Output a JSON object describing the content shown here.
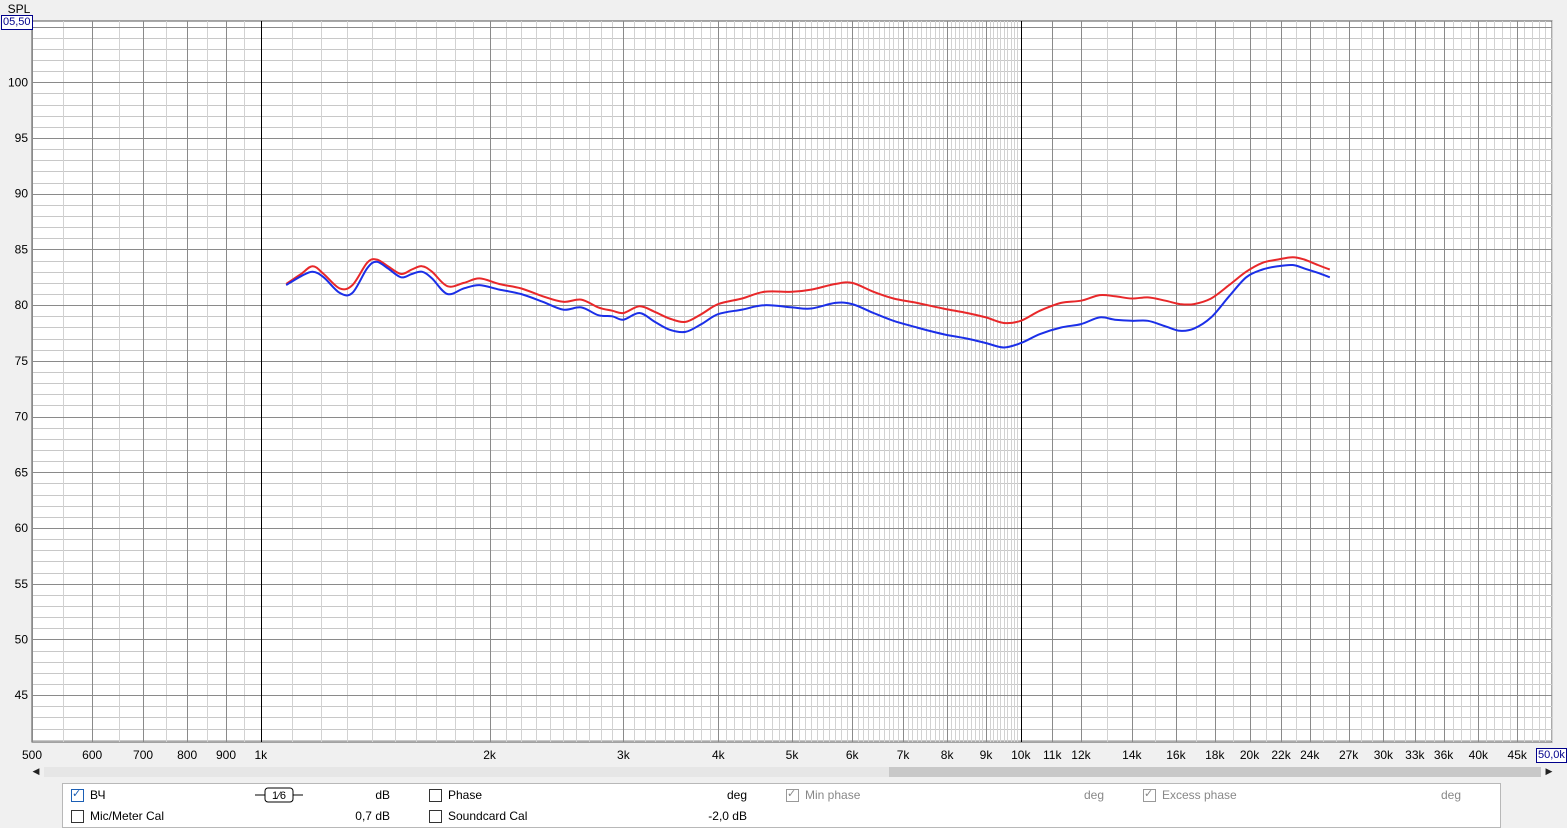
{
  "chart_data": {
    "type": "line",
    "y_axis_title": "SPL",
    "x_scale": "log",
    "xlim": [
      500,
      50000
    ],
    "ylim": [
      40.8,
      105.5
    ],
    "y_ticks": [
      45,
      50,
      55,
      60,
      65,
      70,
      75,
      80,
      85,
      90,
      95,
      100
    ],
    "x_tick_labels": [
      {
        "v": 500,
        "t": "500"
      },
      {
        "v": 600,
        "t": "600"
      },
      {
        "v": 700,
        "t": "700"
      },
      {
        "v": 800,
        "t": "800"
      },
      {
        "v": 900,
        "t": "900"
      },
      {
        "v": 1000,
        "t": "1k"
      },
      {
        "v": 2000,
        "t": "2k"
      },
      {
        "v": 3000,
        "t": "3k"
      },
      {
        "v": 4000,
        "t": "4k"
      },
      {
        "v": 5000,
        "t": "5k"
      },
      {
        "v": 6000,
        "t": "6k"
      },
      {
        "v": 7000,
        "t": "7k"
      },
      {
        "v": 8000,
        "t": "8k"
      },
      {
        "v": 9000,
        "t": "9k"
      },
      {
        "v": 10000,
        "t": "10k"
      },
      {
        "v": 11000,
        "t": "11k"
      },
      {
        "v": 12000,
        "t": "12k"
      },
      {
        "v": 14000,
        "t": "14k"
      },
      {
        "v": 16000,
        "t": "16k"
      },
      {
        "v": 18000,
        "t": "18k"
      },
      {
        "v": 20000,
        "t": "20k"
      },
      {
        "v": 22000,
        "t": "22k"
      },
      {
        "v": 24000,
        "t": "24k"
      },
      {
        "v": 27000,
        "t": "27k"
      },
      {
        "v": 30000,
        "t": "30k"
      },
      {
        "v": 33000,
        "t": "33k"
      },
      {
        "v": 36000,
        "t": "36k"
      },
      {
        "v": 40000,
        "t": "40k"
      },
      {
        "v": 45000,
        "t": "45k"
      }
    ],
    "y_max_readout": "05,50",
    "x_max_readout": "50,0k",
    "grid": true,
    "series": [
      {
        "color": "#e8282a",
        "points": [
          [
            1080,
            81.9
          ],
          [
            1130,
            82.8
          ],
          [
            1170,
            83.5
          ],
          [
            1210,
            82.8
          ],
          [
            1270,
            81.5
          ],
          [
            1320,
            81.8
          ],
          [
            1380,
            83.8
          ],
          [
            1420,
            84.1
          ],
          [
            1470,
            83.5
          ],
          [
            1530,
            82.8
          ],
          [
            1580,
            83.2
          ],
          [
            1630,
            83.5
          ],
          [
            1680,
            83.0
          ],
          [
            1760,
            81.7
          ],
          [
            1850,
            82.0
          ],
          [
            1940,
            82.4
          ],
          [
            2060,
            81.9
          ],
          [
            2200,
            81.5
          ],
          [
            2350,
            80.8
          ],
          [
            2500,
            80.3
          ],
          [
            2640,
            80.5
          ],
          [
            2780,
            79.8
          ],
          [
            2900,
            79.5
          ],
          [
            3000,
            79.3
          ],
          [
            3150,
            79.9
          ],
          [
            3300,
            79.4
          ],
          [
            3450,
            78.8
          ],
          [
            3620,
            78.5
          ],
          [
            3800,
            79.2
          ],
          [
            4000,
            80.1
          ],
          [
            4300,
            80.6
          ],
          [
            4600,
            81.2
          ],
          [
            5000,
            81.2
          ],
          [
            5300,
            81.4
          ],
          [
            5700,
            81.9
          ],
          [
            6000,
            82.0
          ],
          [
            6400,
            81.2
          ],
          [
            6800,
            80.6
          ],
          [
            7300,
            80.2
          ],
          [
            7900,
            79.7
          ],
          [
            8500,
            79.3
          ],
          [
            9000,
            78.9
          ],
          [
            9500,
            78.4
          ],
          [
            10000,
            78.6
          ],
          [
            10600,
            79.5
          ],
          [
            11300,
            80.2
          ],
          [
            12000,
            80.4
          ],
          [
            12700,
            80.9
          ],
          [
            13300,
            80.8
          ],
          [
            14000,
            80.6
          ],
          [
            14700,
            80.7
          ],
          [
            15500,
            80.4
          ],
          [
            16200,
            80.1
          ],
          [
            16900,
            80.1
          ],
          [
            17800,
            80.6
          ],
          [
            18800,
            81.8
          ],
          [
            19800,
            83.0
          ],
          [
            20800,
            83.8
          ],
          [
            21800,
            84.1
          ],
          [
            22800,
            84.3
          ],
          [
            23600,
            84.1
          ],
          [
            24600,
            83.6
          ],
          [
            25500,
            83.2
          ]
        ]
      },
      {
        "color": "#1b2fe8",
        "points": [
          [
            1080,
            81.8
          ],
          [
            1130,
            82.6
          ],
          [
            1170,
            83.0
          ],
          [
            1210,
            82.5
          ],
          [
            1270,
            81.1
          ],
          [
            1320,
            81.1
          ],
          [
            1380,
            83.3
          ],
          [
            1420,
            83.9
          ],
          [
            1470,
            83.3
          ],
          [
            1530,
            82.5
          ],
          [
            1580,
            82.8
          ],
          [
            1630,
            83.0
          ],
          [
            1680,
            82.4
          ],
          [
            1760,
            81.0
          ],
          [
            1850,
            81.5
          ],
          [
            1940,
            81.8
          ],
          [
            2060,
            81.4
          ],
          [
            2200,
            81.0
          ],
          [
            2350,
            80.3
          ],
          [
            2500,
            79.6
          ],
          [
            2640,
            79.8
          ],
          [
            2780,
            79.1
          ],
          [
            2900,
            79.0
          ],
          [
            3000,
            78.7
          ],
          [
            3150,
            79.3
          ],
          [
            3300,
            78.5
          ],
          [
            3450,
            77.8
          ],
          [
            3620,
            77.6
          ],
          [
            3800,
            78.3
          ],
          [
            4000,
            79.2
          ],
          [
            4300,
            79.6
          ],
          [
            4600,
            80.0
          ],
          [
            5000,
            79.8
          ],
          [
            5300,
            79.7
          ],
          [
            5700,
            80.2
          ],
          [
            6000,
            80.1
          ],
          [
            6400,
            79.3
          ],
          [
            6800,
            78.6
          ],
          [
            7300,
            78.0
          ],
          [
            7900,
            77.4
          ],
          [
            8500,
            77.0
          ],
          [
            9000,
            76.6
          ],
          [
            9500,
            76.2
          ],
          [
            10000,
            76.6
          ],
          [
            10600,
            77.4
          ],
          [
            11300,
            78.0
          ],
          [
            12000,
            78.3
          ],
          [
            12700,
            78.9
          ],
          [
            13300,
            78.7
          ],
          [
            14000,
            78.6
          ],
          [
            14700,
            78.6
          ],
          [
            15500,
            78.1
          ],
          [
            16200,
            77.7
          ],
          [
            16900,
            77.9
          ],
          [
            17800,
            78.9
          ],
          [
            18800,
            80.8
          ],
          [
            19800,
            82.5
          ],
          [
            20800,
            83.2
          ],
          [
            21800,
            83.5
          ],
          [
            22800,
            83.6
          ],
          [
            23600,
            83.3
          ],
          [
            24600,
            82.9
          ],
          [
            25500,
            82.5
          ]
        ]
      }
    ]
  },
  "panel": {
    "row1": {
      "trace_label": "ВЧ",
      "smoothing": "1⁄6",
      "db_label": "dB",
      "phase_label": "Phase",
      "deg_label": "deg",
      "min_phase_label": "Min phase",
      "min_phase_deg": "deg",
      "excess_phase_label": "Excess phase",
      "excess_phase_deg": "deg"
    },
    "row2": {
      "mic_label": "Mic/Meter Cal",
      "mic_value": "0,7 dB",
      "soundcard_label": "Soundcard Cal",
      "soundcard_value": "-2,0 dB"
    }
  }
}
